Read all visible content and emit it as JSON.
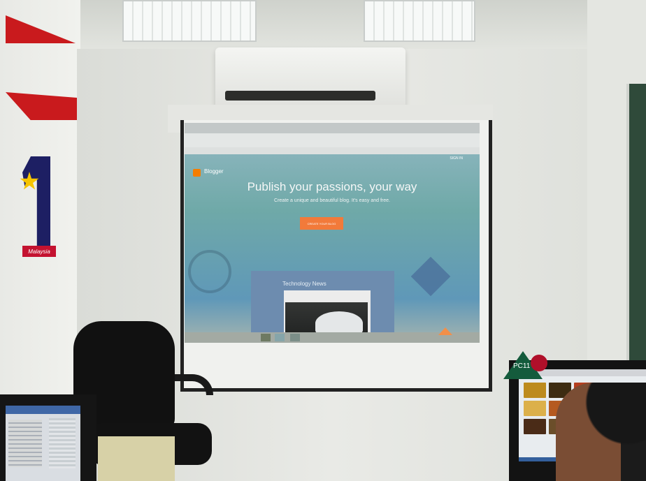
{
  "projected_page": {
    "brand": "Blogger",
    "sign_in": "SIGN IN",
    "headline": "Publish your passions, your way",
    "subheadline": "Create a unique and beautiful blog. It's easy and free.",
    "cta": "CREATE YOUR BLOG",
    "preview_title": "Technology News"
  },
  "badge": {
    "text": "PC11"
  },
  "logo": {
    "text": "Malaysia"
  },
  "colors": {
    "blogger_orange": "#f57d00",
    "cta_orange": "#f27a3a",
    "projector_teal": "#6fa9a8"
  }
}
